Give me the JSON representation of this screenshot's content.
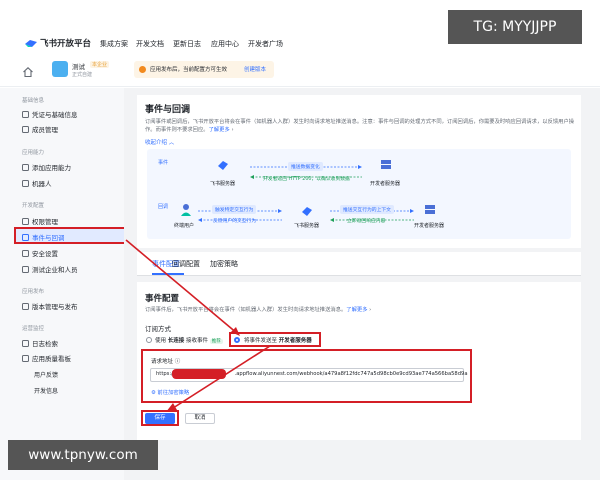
{
  "watermark": {
    "top": "TG: MYYJJPP",
    "bottom": "www.tpnyw.com"
  },
  "nav": {
    "brand": "飞书开放平台",
    "links": [
      "集成方案",
      "开发文档",
      "更新日志",
      "应用中心",
      "开发者广场"
    ]
  },
  "app": {
    "name": "测试",
    "tag": "本企业",
    "sub": "正式自建"
  },
  "notice": {
    "text": "应用发布后，当前配置方可生效",
    "link": "创建版本"
  },
  "sidebar": {
    "groups": [
      {
        "title": "基础信息",
        "items": [
          "凭证与基础信息",
          "成员管理"
        ]
      },
      {
        "title": "应用能力",
        "items": [
          "添加应用能力",
          "机器人"
        ]
      },
      {
        "title": "开发配置",
        "items": [
          "权限管理",
          "事件与回调",
          "安全设置",
          "测试企业和人员"
        ]
      },
      {
        "title": "应用发布",
        "items": [
          "版本管理与发布"
        ]
      },
      {
        "title": "运营监控",
        "items": [
          "日志检索",
          "应用质量看板"
        ]
      }
    ],
    "subitems": [
      "用户反馈",
      "开发信息"
    ],
    "active": "事件与回调"
  },
  "intro": {
    "title": "事件与回调",
    "desc": "订阅事件或回调后，飞书开放平台将会在事件（如机器人入群）发生时向请求地址推送消息。注意：事件与回调的处理方式不同，订阅回调后，你需要及时响应回调请求，以反馈用户操作。而事件则不要求回应。",
    "link": "了解更多",
    "collapse": "收起介绍 ︿",
    "diagram": {
      "event_label": "事件",
      "callback_label": "回调",
      "feishu_server": "飞书服务器",
      "dev_server": "开发者服务器",
      "end_user": "终端用户",
      "push_change": "推送数据变化",
      "http_ok": "开发者返回 HTTP 200，以确认收到数据",
      "trigger": "触发特定交互行为",
      "feedback": "反馈用户的交互行为",
      "push_ctx": "推送交互行为的上下文",
      "resp": "立即返回响应内容"
    }
  },
  "tabs": [
    "事件配置",
    "回调配置",
    "加密策略"
  ],
  "event_config": {
    "title": "事件配置",
    "desc": "订阅事件后，飞书开放平台将会在事件（如机器人入群）发生时向请求地址推送消息。",
    "link": "了解更多",
    "sub_title": "订阅方式",
    "option1_pre": "使用",
    "option1_bold": "长连接",
    "option1_post": "接收事件",
    "option1_badge": "推荐",
    "option2_pre": "将事件发送至",
    "option2_bold": "开发者服务器",
    "req_label": "请求地址 ⓘ",
    "req_value_prefix": "https://",
    "req_value_suffix": ".appflow.aliyunnest.com/webhook/a479a8f12fdc747a5d98cb0e9cd93ae774a566ba58d9a",
    "enc_link": "⚙ 前往加密策略",
    "save": "保存",
    "cancel": "取消"
  }
}
